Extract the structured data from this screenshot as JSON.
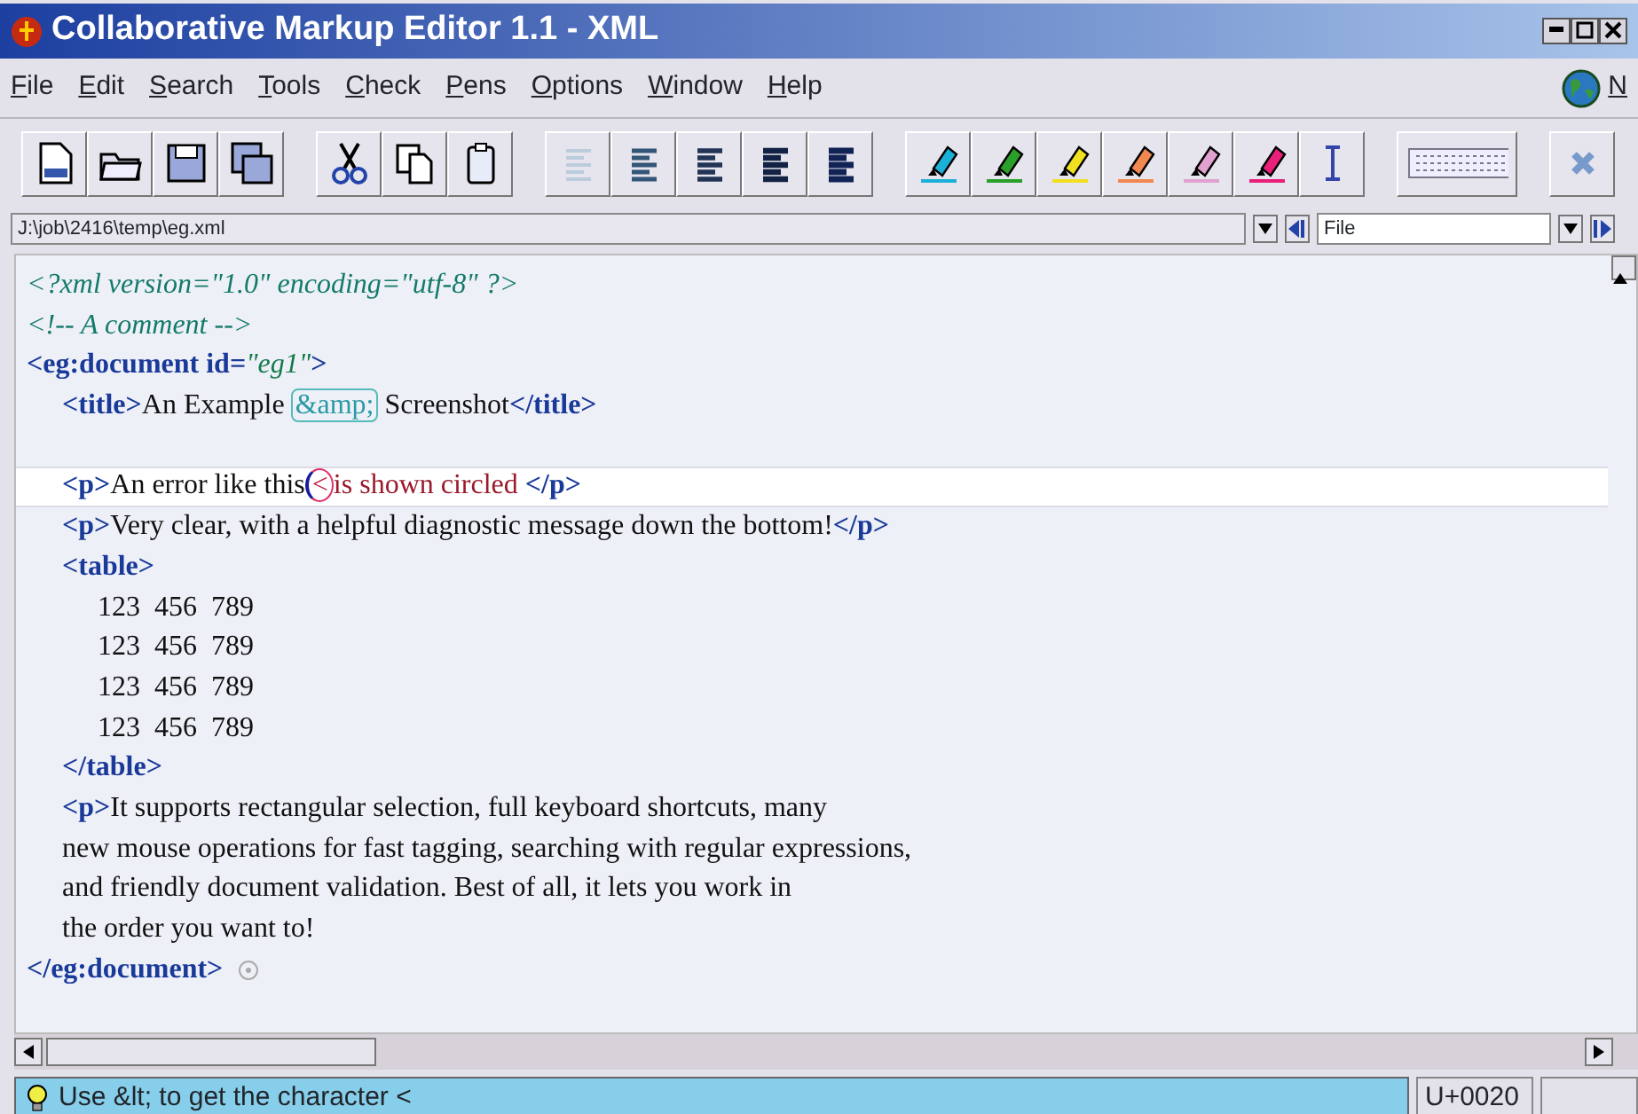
{
  "window": {
    "title": "Collaborative Markup Editor 1.1 - XML"
  },
  "menu": [
    "File",
    "Edit",
    "Search",
    "Tools",
    "Check",
    "Pens",
    "Options",
    "Window",
    "Help"
  ],
  "menu_right": {
    "label": "N"
  },
  "path_bar": {
    "path": "J:\\job\\2416\\temp\\eg.xml",
    "view": "File"
  },
  "editor": {
    "lines": [
      {
        "current": false,
        "segments": [
          {
            "kind": "decl",
            "text": "<?xml version=\"1.0\" encoding=\"utf-8\" ?>"
          }
        ]
      },
      {
        "current": false,
        "segments": [
          {
            "kind": "decl",
            "text": "<!-- A comment -->"
          }
        ]
      },
      {
        "current": false,
        "segments": [
          {
            "kind": "tag",
            "text": "<eg:document id="
          },
          {
            "kind": "value",
            "text": "\"eg1\""
          },
          {
            "kind": "tag",
            "text": ">"
          }
        ],
        "children": [
          {
            "current": false,
            "segments": [
              {
                "kind": "tag",
                "text": "<title>"
              },
              {
                "kind": "text",
                "text": "An Example "
              },
              {
                "kind": "entity",
                "text": "&amp;"
              },
              {
                "kind": "text",
                "text": " Screenshot"
              },
              {
                "kind": "tag",
                "text": "</title>"
              }
            ]
          },
          {
            "current": false
          },
          {
            "current": true,
            "segments": [
              {
                "kind": "tag",
                "text": "<p>"
              },
              {
                "kind": "text",
                "text": "An error like this"
              },
              {
                "kind": "error",
                "text": "<"
              },
              {
                "kind": "errortext",
                "text": "is shown circled "
              },
              {
                "kind": "tag",
                "text": "</p>"
              }
            ]
          },
          {
            "current": false,
            "segments": [
              {
                "kind": "tag",
                "text": "<p>"
              },
              {
                "kind": "text",
                "text": "Very clear, with a helpful diagnostic message down the bottom!"
              },
              {
                "kind": "tag",
                "text": "</p>"
              }
            ]
          },
          {
            "current": false,
            "segments": [
              {
                "kind": "tag",
                "text": "<table>"
              }
            ],
            "children": [
              {
                "current": false,
                "segments": [
                  {
                    "kind": "text",
                    "text": "123  456  789"
                  }
                ]
              },
              {
                "current": false,
                "segments": [
                  {
                    "kind": "text",
                    "text": "123  456  789"
                  }
                ]
              },
              {
                "current": false,
                "segments": [
                  {
                    "kind": "text",
                    "text": "123  456  789"
                  }
                ]
              },
              {
                "current": false,
                "segments": [
                  {
                    "kind": "text",
                    "text": "123  456  789"
                  }
                ]
              }
            ]
          },
          {
            "current": false,
            "segments": [
              {
                "kind": "tag",
                "text": "</table>"
              }
            ]
          },
          {
            "current": false,
            "segments": [
              {
                "kind": "tag",
                "text": "<p>"
              },
              {
                "kind": "text",
                "text": "It supports rectangular selection, full keyboard shortcuts, many"
              }
            ]
          },
          {
            "current": false,
            "segments": [
              {
                "kind": "text",
                "text": "new mouse operations for fast tagging, searching with regular expressions,"
              }
            ]
          },
          {
            "current": false,
            "segments": [
              {
                "kind": "text",
                "text": "and friendly document validation. Best of all, it lets you work in"
              }
            ]
          },
          {
            "current": false,
            "segments": [
              {
                "kind": "text",
                "text": "the order you want to!"
              }
            ]
          }
        ]
      },
      {
        "current": false,
        "segments": [
          {
            "kind": "tag",
            "text": "</eg:document>"
          }
        ],
        "end_mark": true
      }
    ]
  },
  "status_bar": {
    "message": "Use &lt; to get the character <",
    "code": "U+0020"
  }
}
